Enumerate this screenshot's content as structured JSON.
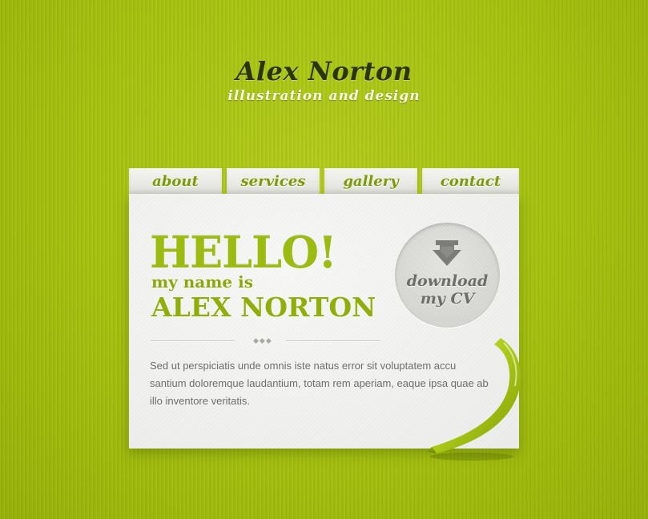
{
  "header": {
    "title": "Alex Norton",
    "tagline": "illustration and design"
  },
  "nav": {
    "items": [
      {
        "label": "about"
      },
      {
        "label": "services"
      },
      {
        "label": "gallery"
      },
      {
        "label": "contact"
      }
    ]
  },
  "card": {
    "hello": "HELLO!",
    "intro": "my name is",
    "name": "ALEX NORTON",
    "divider_dots": "◆◆◆",
    "body": "Sed ut perspiciatis unde omnis iste natus error sit voluptatem accu santium doloremque laudantium, totam rem aperiam, eaque ipsa quae ab illo inventore veritatis.",
    "download": {
      "line1": "download",
      "line2": "my CV",
      "icon": "down-arrow-icon"
    }
  },
  "colors": {
    "background": "#a6c20f",
    "accent": "#9cbb10",
    "paper": "#efefec",
    "title": "#2a3500"
  }
}
